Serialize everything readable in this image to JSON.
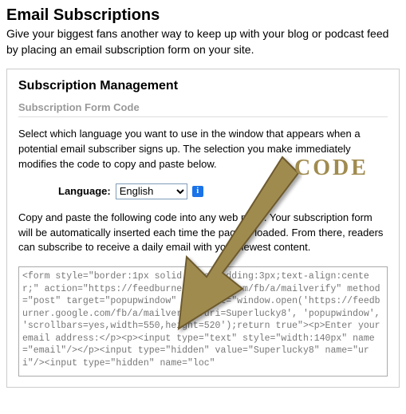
{
  "page": {
    "title": "Email Subscriptions",
    "description": "Give your biggest fans another way to keep up with your blog or podcast feed by placing an email subscription form on your site."
  },
  "panel": {
    "title": "Subscription Management",
    "section": "Subscription Form Code",
    "intro": "Select which language you want to use in the window that appears when a potential email subscriber signs up. The selection you make immediately modifies the code to copy and paste below.",
    "language_label": "Language:",
    "language_selected": "English",
    "info_glyph": "i",
    "copy_instructions": "Copy and paste the following code into any web page. Your subscription form will be automatically inserted each time the page is loaded. From there, readers can subscribe to receive a daily email with your newest content.",
    "code": "<form style=\"border:1px solid #ccc;padding:3px;text-align:center;\" action=\"https://feedburner.google.com/fb/a/mailverify\" method=\"post\" target=\"popupwindow\" onsubmit=\"window.open('https://feedburner.google.com/fb/a/mailverify?uri=Superlucky8', 'popupwindow', 'scrollbars=yes,width=550,height=520');return true\"><p>Enter your email address:</p><p><input type=\"text\" style=\"width:140px\" name=\"email\"/></p><input type=\"hidden\" value=\"Superlucky8\" name=\"uri\"/><input type=\"hidden\" name=\"loc\""
  },
  "annotation": {
    "label": "CODE"
  }
}
